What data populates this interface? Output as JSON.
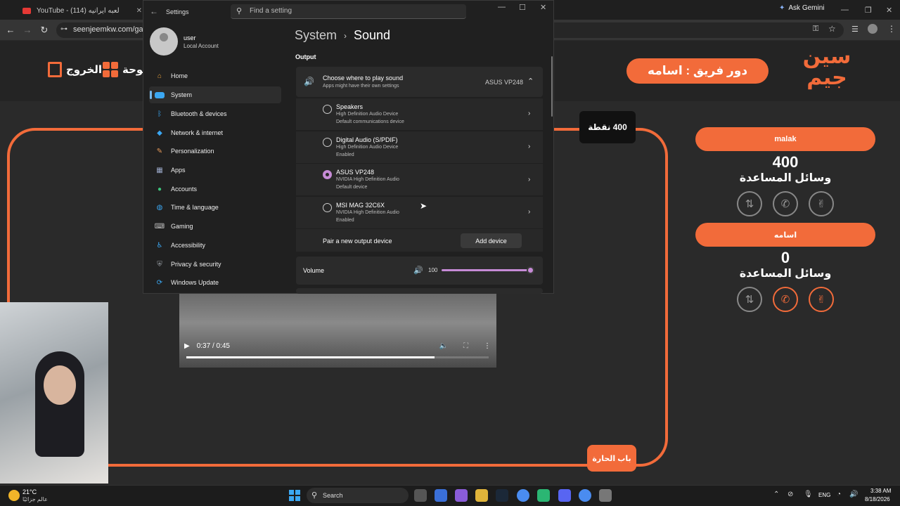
{
  "browser": {
    "tabs": [
      {
        "title": "YouTube - (114) لعبه ايرانيه"
      }
    ],
    "ask_gemini": "Ask Gemini",
    "url": "seenjeemkw.com/game"
  },
  "game": {
    "exit_label": "الخروج",
    "board_label": "لوحة",
    "turn_label": "دور فريق : اسامه",
    "logo_text": "سين جيم",
    "points_badge": "400 نقطة",
    "door_badge": "باب الحارة",
    "teams": [
      {
        "name": "malak",
        "score": "400",
        "aids_label": "وسائل المساعدة"
      },
      {
        "name": "اسامه",
        "score": "0",
        "aids_label": "وسائل المساعدة"
      }
    ],
    "accent_color": "#f26b3a"
  },
  "video": {
    "time": "0:37 / 0:45",
    "progress": 0.82
  },
  "settings": {
    "window_title": "Settings",
    "search_placeholder": "Find a setting",
    "user": {
      "name": "user",
      "type": "Local Account"
    },
    "nav": [
      {
        "label": "Home",
        "icon": "home-icon"
      },
      {
        "label": "System",
        "icon": "system-icon"
      },
      {
        "label": "Bluetooth & devices",
        "icon": "bluetooth-icon"
      },
      {
        "label": "Network & internet",
        "icon": "wifi-icon"
      },
      {
        "label": "Personalization",
        "icon": "brush-icon"
      },
      {
        "label": "Apps",
        "icon": "apps-icon"
      },
      {
        "label": "Accounts",
        "icon": "account-icon"
      },
      {
        "label": "Time & language",
        "icon": "globe-icon"
      },
      {
        "label": "Gaming",
        "icon": "gamepad-icon"
      },
      {
        "label": "Accessibility",
        "icon": "accessibility-icon"
      },
      {
        "label": "Privacy & security",
        "icon": "shield-icon"
      },
      {
        "label": "Windows Update",
        "icon": "update-icon"
      }
    ],
    "breadcrumb": {
      "parent": "System",
      "current": "Sound"
    },
    "output_label": "Output",
    "choose": {
      "title": "Choose where to play sound",
      "subtitle": "Apps might have their own settings",
      "selected": "ASUS VP248"
    },
    "devices": [
      {
        "name": "Speakers",
        "driver": "High Definition Audio Device",
        "status": "Default communications device"
      },
      {
        "name": "Digital Audio (S/PDIF)",
        "driver": "High Definition Audio Device",
        "status": "Enabled"
      },
      {
        "name": "ASUS VP248",
        "driver": "NVIDIA High Definition Audio",
        "status": "Default device"
      },
      {
        "name": "MSI MAG 32C6X",
        "driver": "NVIDIA High Definition Audio",
        "status": "Enabled"
      }
    ],
    "pair_label": "Pair a new output device",
    "add_device": "Add device",
    "volume_label": "Volume",
    "volume_value": "100"
  },
  "taskbar": {
    "weather_temp": "21°C",
    "weather_desc": "عالم جزائيًا",
    "search": "Search",
    "lang": "ENG",
    "time": "3:38 AM",
    "date": "8/18/2026"
  }
}
